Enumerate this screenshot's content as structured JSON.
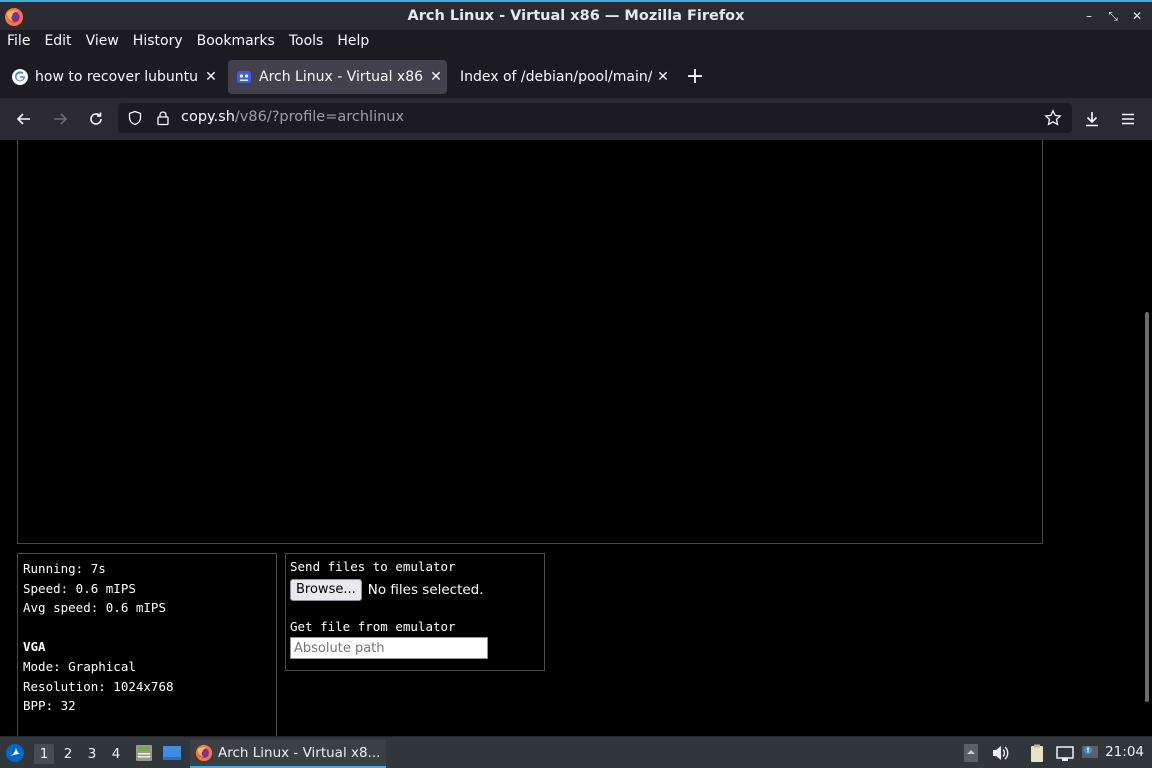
{
  "window": {
    "title": "Arch Linux - Virtual x86 — Mozilla Firefox",
    "controls": {
      "minimize": "–",
      "maximize": "⤡",
      "close": "✕"
    }
  },
  "menubar": {
    "items": [
      "File",
      "Edit",
      "View",
      "History",
      "Bookmarks",
      "Tools",
      "Help"
    ]
  },
  "tabs": [
    {
      "label": "how to recover lubuntu w",
      "icon": "google-icon",
      "active": false
    },
    {
      "label": "Arch Linux - Virtual x86",
      "icon": "v86-icon",
      "active": true
    },
    {
      "label": "Index of /debian/pool/main/b",
      "icon": "none",
      "active": false
    }
  ],
  "tab_close": "✕",
  "new_tab": "+",
  "navbar": {
    "url_host": "copy.sh",
    "url_path": "/v86/?profile=archlinux"
  },
  "emulator": {
    "stats": {
      "running": "Running: 7s",
      "speed": "Speed: 0.6 mIPS",
      "avg_speed": "Avg speed: 0.6 mIPS",
      "vga_heading": "VGA",
      "mode": "Mode: Graphical",
      "resolution": "Resolution: 1024x768",
      "bpp": "BPP: 32"
    },
    "files": {
      "send_heading": "Send files to emulator",
      "browse_label": "Browse...",
      "no_files": "No files selected.",
      "get_heading": "Get file from emulator",
      "path_placeholder": "Absolute path"
    }
  },
  "taskbar": {
    "workspaces": [
      "1",
      "2",
      "3",
      "4"
    ],
    "active_workspace": "1",
    "window_label": "Arch Linux - Virtual x8...",
    "clock": "21:04"
  },
  "colors": {
    "accent": "#3daee9",
    "tab_active": "#42414d",
    "toolbar": "#2b2a33"
  }
}
